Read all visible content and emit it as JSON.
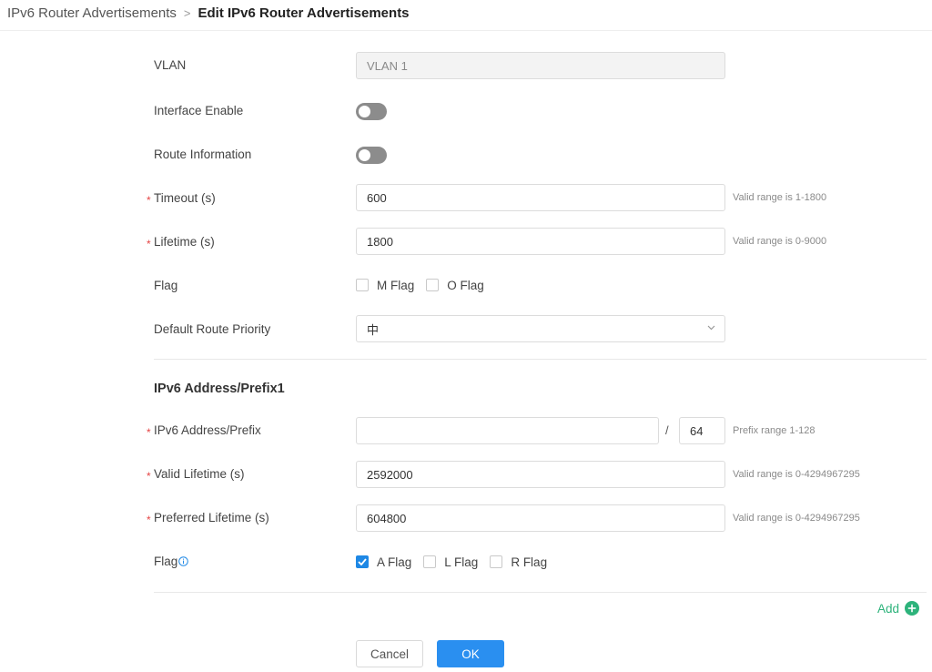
{
  "breadcrumb": {
    "parent": "IPv6 Router Advertisements",
    "separator": ">",
    "current": "Edit IPv6 Router Advertisements"
  },
  "form": {
    "vlan": {
      "label": "VLAN",
      "value": "VLAN 1"
    },
    "interface_enable": {
      "label": "Interface Enable",
      "on": false
    },
    "route_information": {
      "label": "Route Information",
      "on": false
    },
    "timeout": {
      "required": "*",
      "label": "Timeout (s)",
      "value": "600",
      "hint": "Valid range is 1-1800"
    },
    "lifetime": {
      "required": "*",
      "label": "Lifetime (s)",
      "value": "1800",
      "hint": "Valid range is 0-9000"
    },
    "flag": {
      "label": "Flag",
      "options": [
        {
          "label": "M Flag",
          "checked": false
        },
        {
          "label": "O Flag",
          "checked": false
        }
      ]
    },
    "default_route_priority": {
      "label": "Default Route Priority",
      "value": "中"
    }
  },
  "prefix_section": {
    "title": "IPv6 Address/Prefix1",
    "address": {
      "required": "*",
      "label": "IPv6 Address/Prefix",
      "value": "",
      "separator": "/",
      "prefix_length": "64",
      "hint": "Prefix range 1-128"
    },
    "valid_lifetime": {
      "required": "*",
      "label": "Valid Lifetime (s)",
      "value": "2592000",
      "hint": "Valid range is 0-4294967295"
    },
    "preferred_lifetime": {
      "required": "*",
      "label": "Preferred Lifetime (s)",
      "value": "604800",
      "hint": "Valid range is 0-4294967295"
    },
    "flag": {
      "label": "Flag",
      "options": [
        {
          "label": "A Flag",
          "checked": true
        },
        {
          "label": "L Flag",
          "checked": false
        },
        {
          "label": "R Flag",
          "checked": false
        }
      ]
    }
  },
  "add_label": "Add",
  "buttons": {
    "cancel": "Cancel",
    "ok": "OK"
  },
  "colors": {
    "accent_blue": "#2a8ff0",
    "add_green": "#2db37b",
    "required_red": "#e54545",
    "toggle_off": "#8c8c8c"
  },
  "icons": {
    "breadcrumb_separator": "chevron-right-icon",
    "select_arrow": "chevron-down-icon",
    "info": "info-icon",
    "add": "plus-circle-icon",
    "check": "check-icon"
  }
}
